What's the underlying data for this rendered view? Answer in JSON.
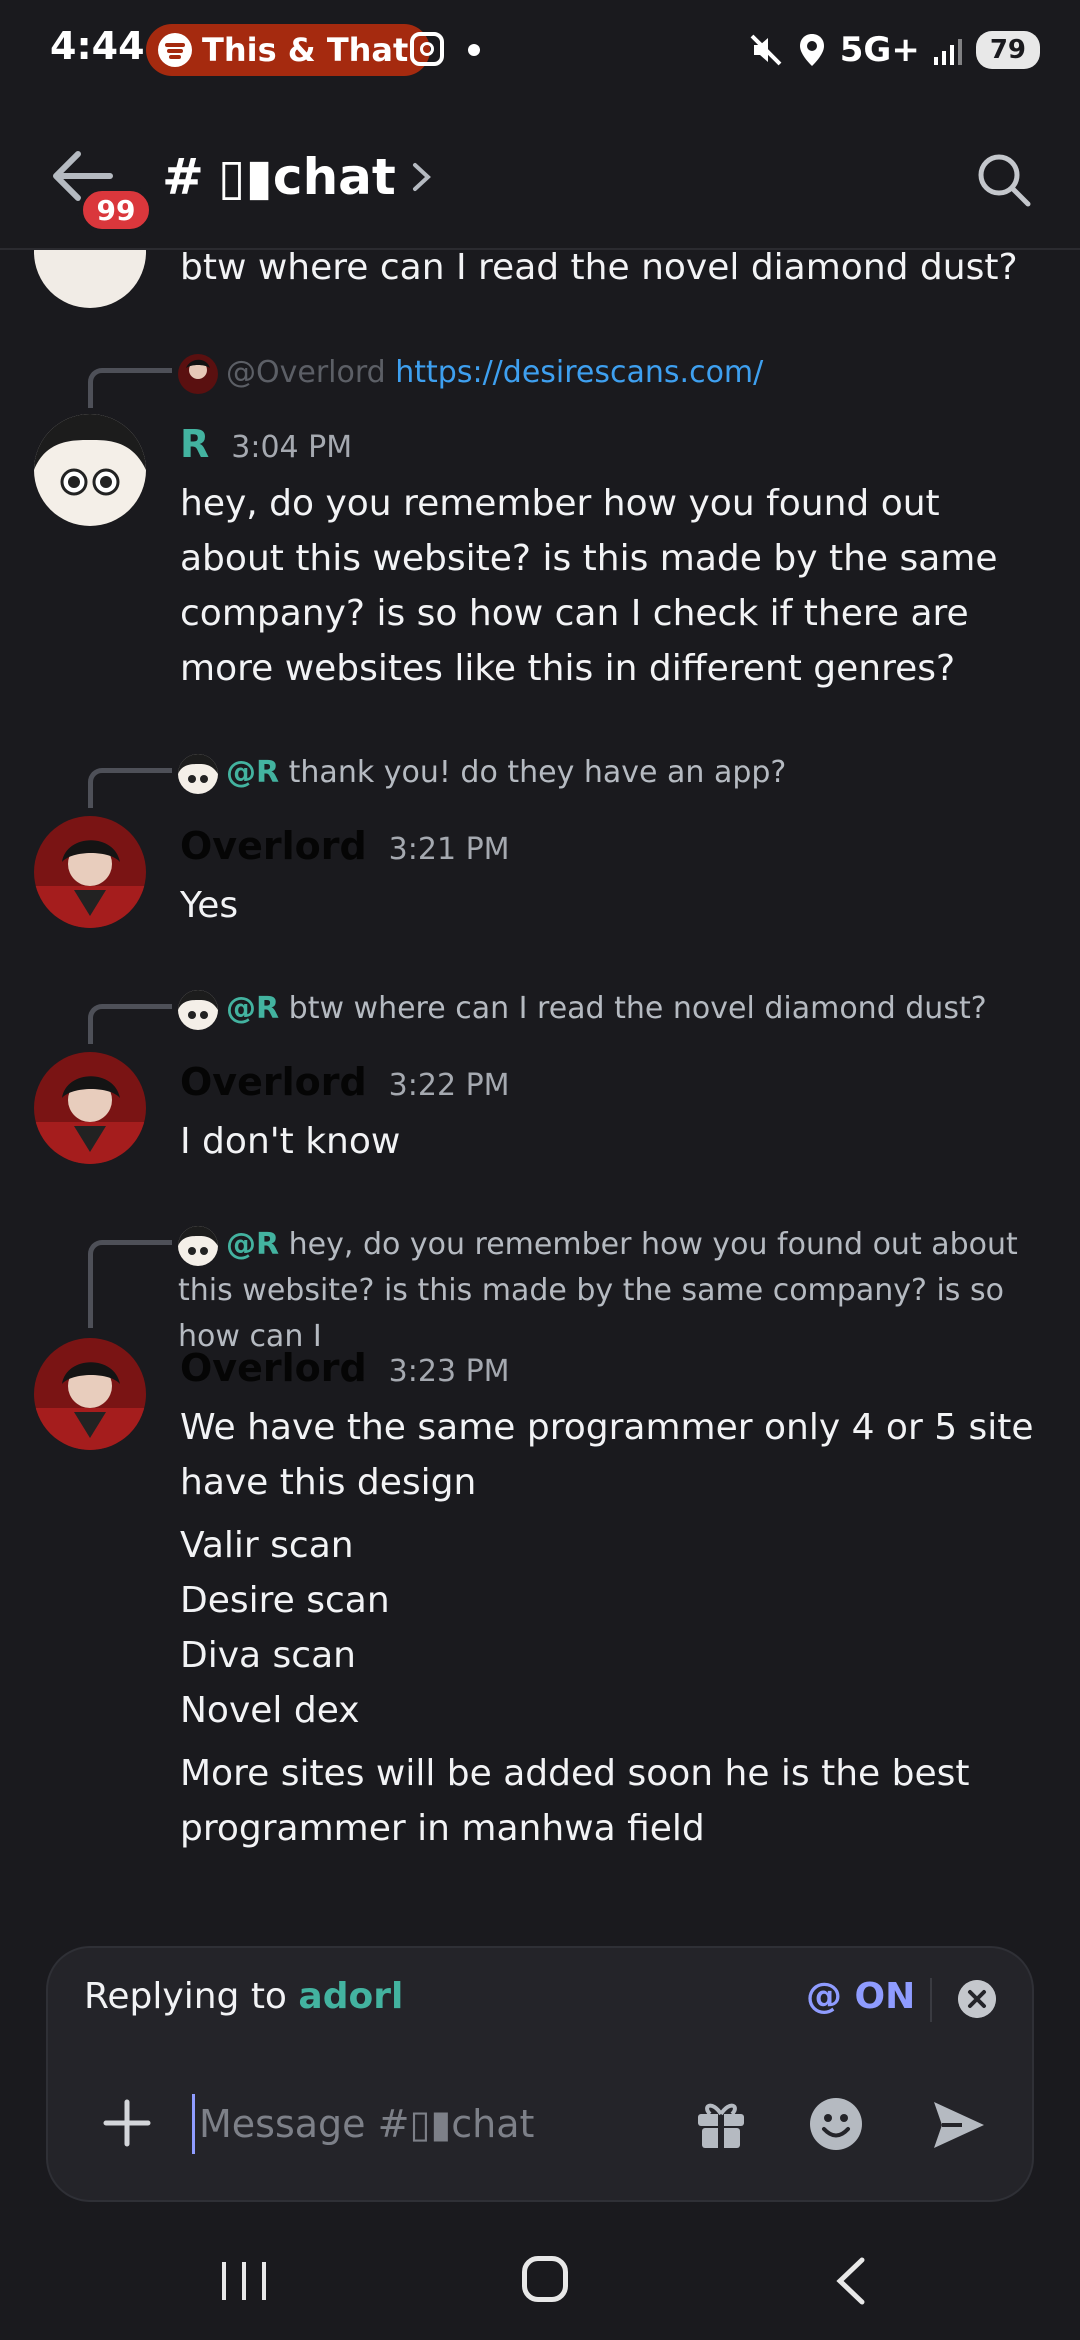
{
  "status_bar": {
    "time": "4:44",
    "media_pill": "This & That",
    "network": "5G+",
    "battery": "79"
  },
  "header": {
    "unread_badge": "99",
    "channel_hash": "#",
    "channel_name": "▯▮chat"
  },
  "top_partial_message": "btw where can I read the novel diamond dust?",
  "messages": [
    {
      "reply": {
        "author": "@Overlord",
        "text": "https://desirescans.com/"
      },
      "author": "R",
      "time": "3:04 PM",
      "lines": [
        "hey, do you remember how you found out about this website? is this made by the same company? is so how can I check if there are more websites like this in different genres?"
      ]
    },
    {
      "reply": {
        "author": "@R",
        "text": "thank you! do they have an app?"
      },
      "author": "Overlord",
      "time": "3:21 PM",
      "lines": [
        "Yes"
      ]
    },
    {
      "reply": {
        "author": "@R",
        "text": "btw where can I read the novel diamond dust?"
      },
      "author": "Overlord",
      "time": "3:22 PM",
      "lines": [
        "I don't know"
      ]
    },
    {
      "reply": {
        "author": "@R",
        "text": "hey, do you remember how you found out about this website? is this made by the same company? is so how can I"
      },
      "author": "Overlord",
      "time": "3:23 PM",
      "lines": [
        "We have the same programmer only 4 or 5 site have this design",
        "Valir scan",
        "Desire scan",
        "Diva scan",
        "Novel dex",
        "More sites will be added soon he is the best programmer in manhwa field"
      ]
    }
  ],
  "composer": {
    "replying_prefix": "Replying to",
    "replying_to": "adorl",
    "mention_toggle": "@ ON",
    "placeholder": "Message #▯▮chat"
  },
  "colors": {
    "background": "#1a1a1e",
    "mention_teal": "#43b3a0",
    "link_blue": "#3ea0f0",
    "badge_red": "#da373c",
    "accent": "#8f9cff"
  },
  "icons": [
    "spotify-icon",
    "instagram-icon",
    "mute-icon",
    "location-icon",
    "signal-icon",
    "back-arrow-icon",
    "chevron-right-icon",
    "search-icon",
    "close-icon",
    "plus-icon",
    "gift-icon",
    "emoji-icon",
    "send-icon"
  ]
}
